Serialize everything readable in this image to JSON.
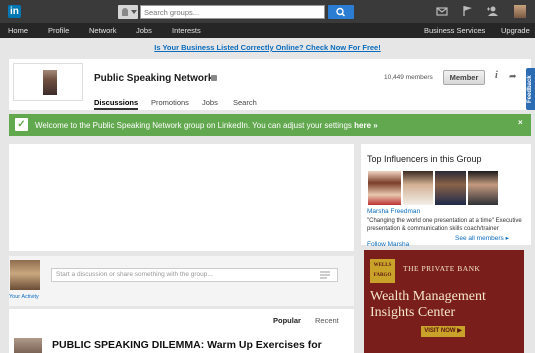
{
  "header": {
    "logo_text": "in",
    "search_placeholder": "Search groups...",
    "nav": [
      "Home",
      "Profile",
      "Network",
      "Jobs",
      "Interests"
    ],
    "nav_right": [
      "Business Services",
      "Upgrade"
    ]
  },
  "promo": "Is Your Business Listed Correctly Online? Check Now For Free!",
  "group": {
    "title": "Public Speaking Network",
    "members": "10,449 members",
    "member_button": "Member",
    "tabs": [
      "Discussions",
      "Promotions",
      "Jobs",
      "Search"
    ],
    "info_glyph": "i",
    "share_glyph": "➦",
    "feedback": "Feedback"
  },
  "welcome": {
    "check_glyph": "✓",
    "message_prefix": "Welcome to the Public Speaking Network group on LinkedIn. You can adjust your settings ",
    "message_link": "here »",
    "close_glyph": "×"
  },
  "composer": {
    "your_activity": "Your Activity",
    "placeholder": "Start a discussion or share something with the group..."
  },
  "feed": {
    "sort_popular": "Popular",
    "sort_recent": "Recent",
    "first_title": "PUBLIC SPEAKING DILEMMA: Warm Up Exercises for"
  },
  "influencers": {
    "title": "Top Influencers in this Group",
    "name": "Marsha Freedman",
    "quote": "\"Changing the world one presentation at a time\" Executive presentation & communication skills coach/trainer",
    "see_all": "See all members ▸",
    "follow": "Follow Marsha"
  },
  "ad": {
    "logo_line1": "WELLS",
    "logo_line2": "FARGO",
    "brand": "THE PRIVATE BANK",
    "headline1": "Wealth Management",
    "headline2": "Insights Center",
    "button": "VISIT NOW ▶"
  },
  "colors": {
    "linkedin_blue": "#0077b5",
    "welcome_green": "#62a84e",
    "ad_background": "#7a1e1b",
    "ad_gold": "#c9a22a",
    "link_blue": "#0b6cbd"
  }
}
